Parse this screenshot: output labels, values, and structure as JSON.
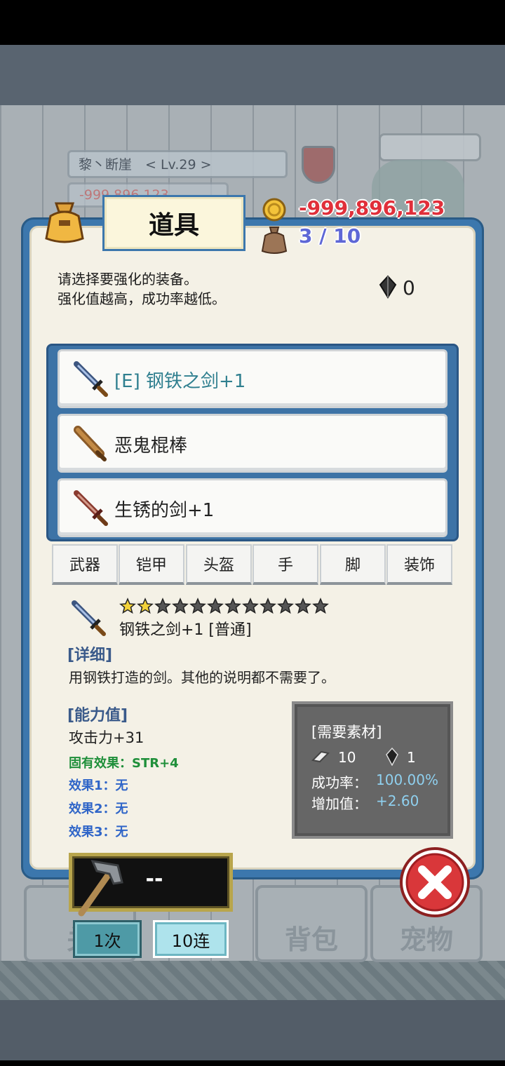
{
  "background": {
    "player_name": "黎丶断崖　< Lv.29 >",
    "player_gold": "-999,896,123",
    "tab_labels": [
      "关",
      "背包",
      "宠物"
    ]
  },
  "header": {
    "title": "道具",
    "gold": "-999,896,123",
    "capacity": "3 / 10"
  },
  "instructions": {
    "line1": "请选择要强化的装备。",
    "line2": "强化值越高，成功率越低。",
    "gem_count": "0"
  },
  "items": [
    {
      "label": "[E] 钢铁之剑+1",
      "selected": true,
      "icon": "steel-sword-icon"
    },
    {
      "label": "恶鬼棍棒",
      "selected": false,
      "icon": "club-icon"
    },
    {
      "label": "生锈的剑+1",
      "selected": false,
      "icon": "rusty-sword-icon"
    }
  ],
  "categories": [
    "武器",
    "铠甲",
    "头盔",
    "手",
    "脚",
    "装饰"
  ],
  "detail": {
    "name": "钢铁之剑+1 [普通]",
    "stars_filled": 2,
    "stars_total": 12,
    "detail_label": "[详细]",
    "description": "用钢铁打造的剑。其他的说明都不需要了。",
    "stats_label": "[能力值]",
    "attack": "攻击力+31",
    "fixed_effect": "固有效果：STR+4",
    "effect1": "效果1：无",
    "effect2": "效果2：无",
    "effect3": "效果3：无"
  },
  "materials": {
    "title": "[需要素材]",
    "bar_count": "10",
    "gem_count": "1",
    "rate_label": "成功率：",
    "rate_value": "100.00%",
    "increase_label": "增加值：",
    "increase_value": "+2.60"
  },
  "enhance": {
    "value": "--",
    "once_label": "1次",
    "ten_label": "10连"
  },
  "colors": {
    "panel_blue": "#3c77ad",
    "gold_red": "#e02f3a",
    "capacity_blue": "#5e67d6",
    "fixed_green": "#1f8f3a",
    "effect_blue": "#2f65c8"
  }
}
